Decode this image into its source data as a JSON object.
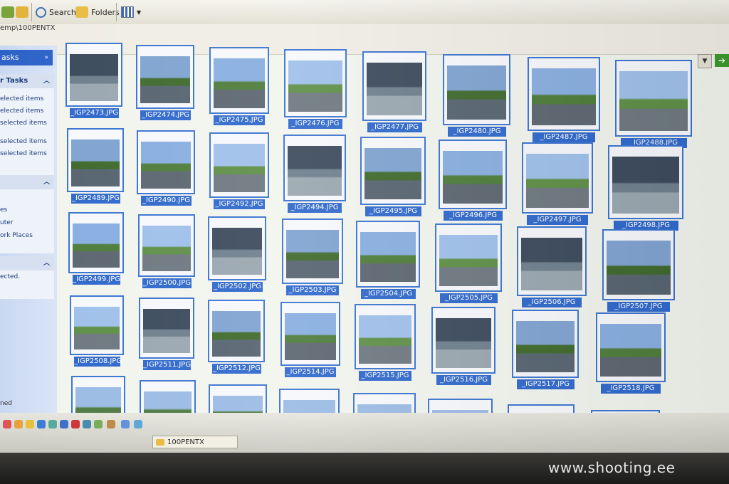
{
  "toolbar": {
    "search_label": "Search",
    "folders_label": "Folders",
    "views_icon": "views-grid-icon",
    "search_icon": "magnifier-icon",
    "folders_icon": "folder-icon",
    "back_icon": "folder-up-icon"
  },
  "address": {
    "path_text": "emp\\100PENTX",
    "go_icon": "go-arrow-icon",
    "dropdown_icon": "chevron-down-icon"
  },
  "taskpane": {
    "header": "asks",
    "section1_title": "r Tasks",
    "section1_items": [
      "elected items",
      "elected items",
      "selected items",
      "",
      "selected items",
      "selected items"
    ],
    "section2_items": [
      "es",
      "uter",
      "ork Places"
    ],
    "section3_items": [
      "ected."
    ]
  },
  "thumbnails": [
    [
      "_IGP2473.JPG",
      "_IGP2474.JPG",
      "_IGP2475.JPG",
      "_IGP2476.JPG",
      "_IGP2477.JPG",
      "_IGP2480.JPG",
      "_IGP2487.JPG",
      "_IGP2488.JPG"
    ],
    [
      "_IGP2489.JPG",
      "_IGP2490.JPG",
      "_IGP2492.JPG",
      "_IGP2494.JPG",
      "_IGP2495.JPG",
      "_IGP2496.JPG",
      "_IGP2497.JPG",
      "_IGP2498.JPG"
    ],
    [
      "_IGP2499.JPG",
      "_IGP2500.JPG",
      "_IGP2502.JPG",
      "_IGP2503.JPG",
      "_IGP2504.JPG",
      "_IGP2505.JPG",
      "_IGP2506.JPG",
      "_IGP2507.JPG"
    ],
    [
      "_IGP2508.JPG",
      "_IGP2511.JPG",
      "_IGP2512.JPG",
      "_IGP2514.JPG",
      "_IGP2515.JPG",
      "_IGP2516.JPG",
      "_IGP2517.JPG",
      "_IGP2518.JPG"
    ]
  ],
  "status_text": "ned",
  "taskbar": {
    "window_button": "100PENTX"
  },
  "watermark": "www.shooting.ee",
  "colors": {
    "selection": "#2f68cc",
    "border": "#3a74d0",
    "pane": "#d9e4f7"
  }
}
